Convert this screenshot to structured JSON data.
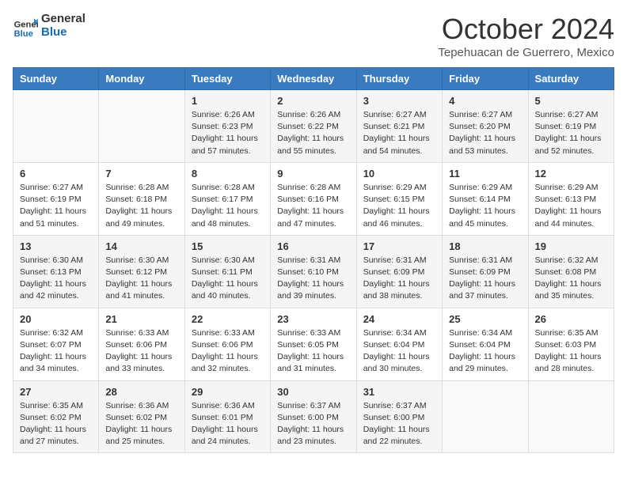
{
  "header": {
    "logo_line1": "General",
    "logo_line2": "Blue",
    "month": "October 2024",
    "location": "Tepehuacan de Guerrero, Mexico"
  },
  "days_of_week": [
    "Sunday",
    "Monday",
    "Tuesday",
    "Wednesday",
    "Thursday",
    "Friday",
    "Saturday"
  ],
  "weeks": [
    [
      {
        "day": "",
        "info": ""
      },
      {
        "day": "",
        "info": ""
      },
      {
        "day": "1",
        "info": "Sunrise: 6:26 AM\nSunset: 6:23 PM\nDaylight: 11 hours and 57 minutes."
      },
      {
        "day": "2",
        "info": "Sunrise: 6:26 AM\nSunset: 6:22 PM\nDaylight: 11 hours and 55 minutes."
      },
      {
        "day": "3",
        "info": "Sunrise: 6:27 AM\nSunset: 6:21 PM\nDaylight: 11 hours and 54 minutes."
      },
      {
        "day": "4",
        "info": "Sunrise: 6:27 AM\nSunset: 6:20 PM\nDaylight: 11 hours and 53 minutes."
      },
      {
        "day": "5",
        "info": "Sunrise: 6:27 AM\nSunset: 6:19 PM\nDaylight: 11 hours and 52 minutes."
      }
    ],
    [
      {
        "day": "6",
        "info": "Sunrise: 6:27 AM\nSunset: 6:19 PM\nDaylight: 11 hours and 51 minutes."
      },
      {
        "day": "7",
        "info": "Sunrise: 6:28 AM\nSunset: 6:18 PM\nDaylight: 11 hours and 49 minutes."
      },
      {
        "day": "8",
        "info": "Sunrise: 6:28 AM\nSunset: 6:17 PM\nDaylight: 11 hours and 48 minutes."
      },
      {
        "day": "9",
        "info": "Sunrise: 6:28 AM\nSunset: 6:16 PM\nDaylight: 11 hours and 47 minutes."
      },
      {
        "day": "10",
        "info": "Sunrise: 6:29 AM\nSunset: 6:15 PM\nDaylight: 11 hours and 46 minutes."
      },
      {
        "day": "11",
        "info": "Sunrise: 6:29 AM\nSunset: 6:14 PM\nDaylight: 11 hours and 45 minutes."
      },
      {
        "day": "12",
        "info": "Sunrise: 6:29 AM\nSunset: 6:13 PM\nDaylight: 11 hours and 44 minutes."
      }
    ],
    [
      {
        "day": "13",
        "info": "Sunrise: 6:30 AM\nSunset: 6:13 PM\nDaylight: 11 hours and 42 minutes."
      },
      {
        "day": "14",
        "info": "Sunrise: 6:30 AM\nSunset: 6:12 PM\nDaylight: 11 hours and 41 minutes."
      },
      {
        "day": "15",
        "info": "Sunrise: 6:30 AM\nSunset: 6:11 PM\nDaylight: 11 hours and 40 minutes."
      },
      {
        "day": "16",
        "info": "Sunrise: 6:31 AM\nSunset: 6:10 PM\nDaylight: 11 hours and 39 minutes."
      },
      {
        "day": "17",
        "info": "Sunrise: 6:31 AM\nSunset: 6:09 PM\nDaylight: 11 hours and 38 minutes."
      },
      {
        "day": "18",
        "info": "Sunrise: 6:31 AM\nSunset: 6:09 PM\nDaylight: 11 hours and 37 minutes."
      },
      {
        "day": "19",
        "info": "Sunrise: 6:32 AM\nSunset: 6:08 PM\nDaylight: 11 hours and 35 minutes."
      }
    ],
    [
      {
        "day": "20",
        "info": "Sunrise: 6:32 AM\nSunset: 6:07 PM\nDaylight: 11 hours and 34 minutes."
      },
      {
        "day": "21",
        "info": "Sunrise: 6:33 AM\nSunset: 6:06 PM\nDaylight: 11 hours and 33 minutes."
      },
      {
        "day": "22",
        "info": "Sunrise: 6:33 AM\nSunset: 6:06 PM\nDaylight: 11 hours and 32 minutes."
      },
      {
        "day": "23",
        "info": "Sunrise: 6:33 AM\nSunset: 6:05 PM\nDaylight: 11 hours and 31 minutes."
      },
      {
        "day": "24",
        "info": "Sunrise: 6:34 AM\nSunset: 6:04 PM\nDaylight: 11 hours and 30 minutes."
      },
      {
        "day": "25",
        "info": "Sunrise: 6:34 AM\nSunset: 6:04 PM\nDaylight: 11 hours and 29 minutes."
      },
      {
        "day": "26",
        "info": "Sunrise: 6:35 AM\nSunset: 6:03 PM\nDaylight: 11 hours and 28 minutes."
      }
    ],
    [
      {
        "day": "27",
        "info": "Sunrise: 6:35 AM\nSunset: 6:02 PM\nDaylight: 11 hours and 27 minutes."
      },
      {
        "day": "28",
        "info": "Sunrise: 6:36 AM\nSunset: 6:02 PM\nDaylight: 11 hours and 25 minutes."
      },
      {
        "day": "29",
        "info": "Sunrise: 6:36 AM\nSunset: 6:01 PM\nDaylight: 11 hours and 24 minutes."
      },
      {
        "day": "30",
        "info": "Sunrise: 6:37 AM\nSunset: 6:00 PM\nDaylight: 11 hours and 23 minutes."
      },
      {
        "day": "31",
        "info": "Sunrise: 6:37 AM\nSunset: 6:00 PM\nDaylight: 11 hours and 22 minutes."
      },
      {
        "day": "",
        "info": ""
      },
      {
        "day": "",
        "info": ""
      }
    ]
  ]
}
